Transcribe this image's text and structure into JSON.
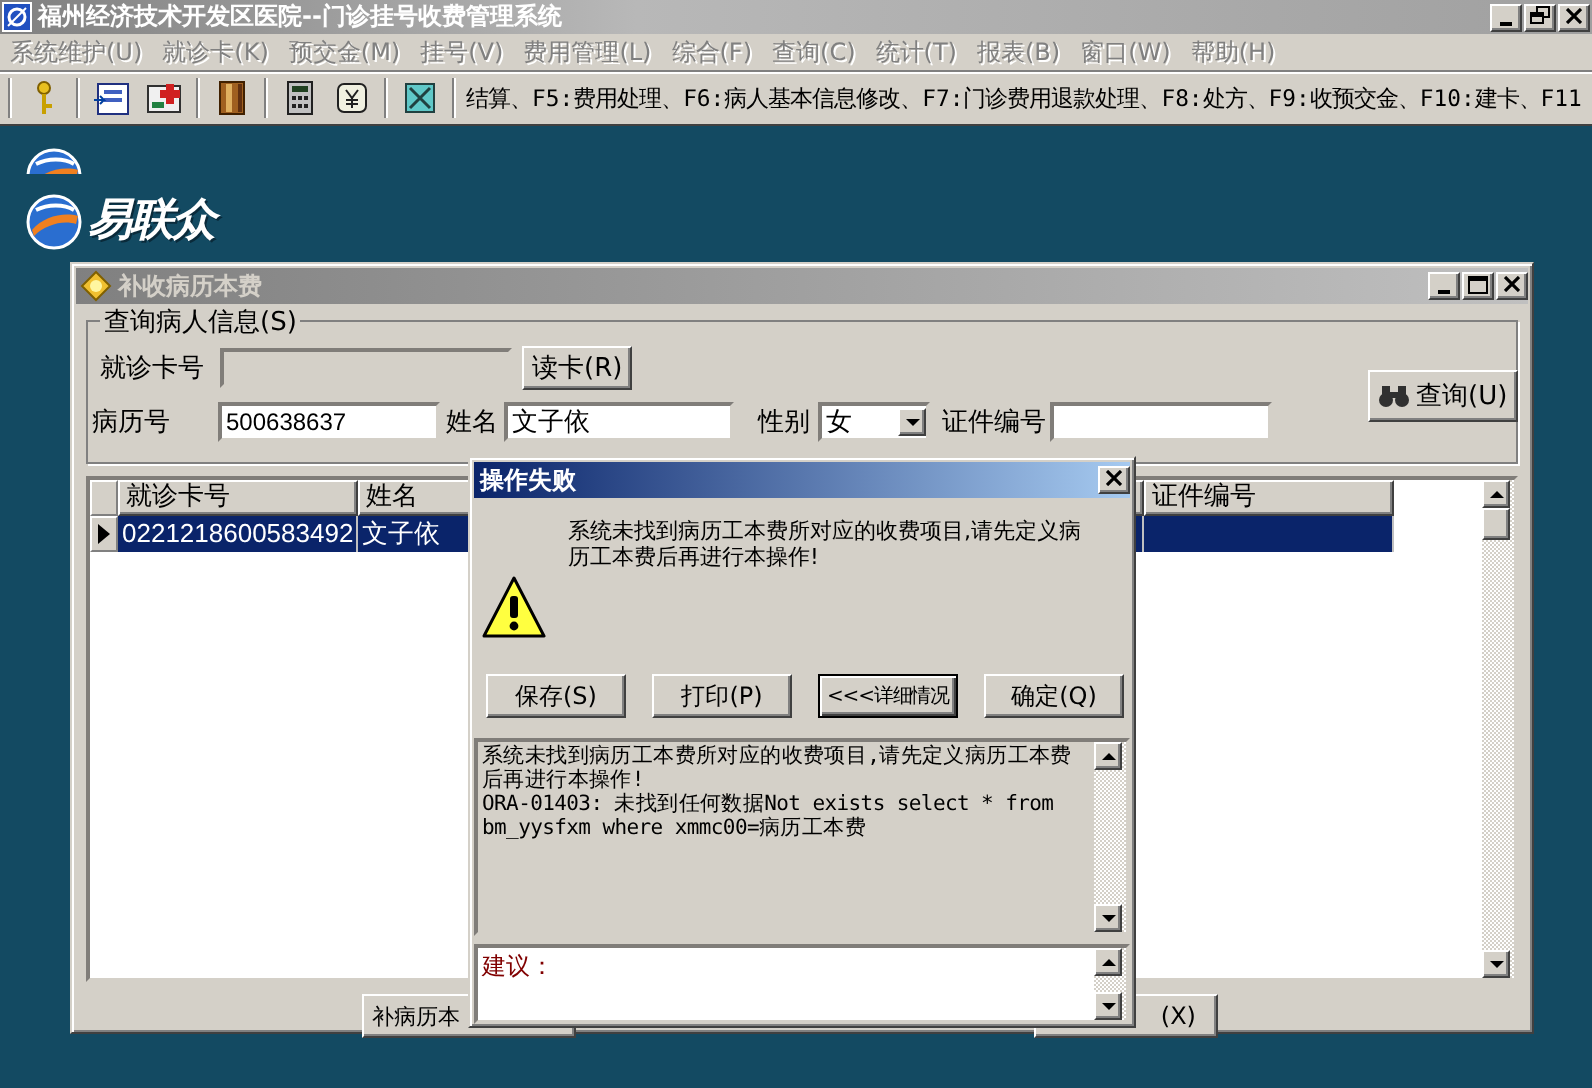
{
  "window": {
    "title": "福州经济技术开发区医院--门诊挂号收费管理系统"
  },
  "menu": [
    {
      "label": "系统维护(U)",
      "disabled": true
    },
    {
      "label": "就诊卡(K)",
      "disabled": true
    },
    {
      "label": "预交金(M)",
      "disabled": true
    },
    {
      "label": "挂号(V)",
      "disabled": true
    },
    {
      "label": "费用管理(L)",
      "disabled": true
    },
    {
      "label": "综合(F)",
      "disabled": true
    },
    {
      "label": "查询(C)",
      "disabled": true
    },
    {
      "label": "统计(T)",
      "disabled": true
    },
    {
      "label": "报表(B)",
      "disabled": true
    },
    {
      "label": "窗口(W)",
      "disabled": true
    },
    {
      "label": "帮助(H)",
      "disabled": true
    }
  ],
  "toolbar": {
    "buttons": [
      {
        "kind": "key"
      },
      {
        "kind": "card"
      },
      {
        "kind": "medkit"
      },
      {
        "kind": "book"
      },
      {
        "kind": "calculator"
      },
      {
        "kind": "money"
      },
      {
        "kind": "exit"
      }
    ],
    "hint": "结算、F5:费用处理、F6:病人基本信息修改、F7:门诊费用退款处理、F8:处方、F9:收预交金、F10:建卡、F11"
  },
  "desktop": {
    "logos": [
      {
        "clipped": true
      },
      {
        "text": "易联众",
        "clipped": false
      }
    ]
  },
  "child_window": {
    "title": "补收病历本费",
    "query_group": {
      "title": "查询病人信息(S)",
      "card_label": "就诊卡号",
      "read_button": "读卡(R)",
      "record_label": "病历号",
      "record_value": "500638637",
      "name_label": "姓名",
      "name_value": "文子依",
      "sex_label": "性别",
      "sex_value": "女",
      "id_label": "证件编号",
      "query_button": "查询(U)"
    },
    "grid": {
      "columns": [
        "就诊卡号",
        "姓名",
        "证件编号"
      ],
      "rows": [
        {
          "cells": [
            "0221218600583492",
            "文子依",
            ""
          ],
          "selected": true
        }
      ]
    },
    "buttons": [
      "补病历本",
      "(X)"
    ]
  },
  "dialog": {
    "title": "操作失败",
    "message": "系统未找到病历工本费所对应的收费项目,请先定义病历工本费后再进行本操作!",
    "buttons": [
      {
        "label": "保存(S)",
        "selected": false
      },
      {
        "label": "打印(P)",
        "selected": false
      },
      {
        "label": "<<<详细情况",
        "selected": true
      },
      {
        "label": "确定(Q)",
        "selected": false
      }
    ],
    "detail": [
      "系统未找到病历工本费所对应的收费项目,请先定义病历工本费后再进行本操作!",
      "ORA-01403: 未找到任何数据Not exists select * from bm_yysfxm where xmmc00=病历工本费"
    ],
    "suggestion_label": "建议："
  }
}
